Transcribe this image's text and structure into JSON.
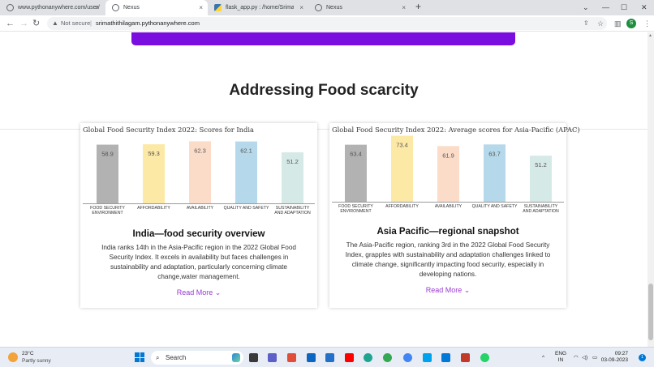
{
  "browser": {
    "tabs": [
      {
        "title": "www.pythonanywhere.com/user/",
        "favicon": "globe-icon",
        "active": false
      },
      {
        "title": "Nexus",
        "favicon": "globe-icon",
        "active": true
      },
      {
        "title": "flask_app.py : /home/SrimathiTh",
        "favicon": "python-icon",
        "active": false
      },
      {
        "title": "Nexus",
        "favicon": "globe-icon",
        "active": false
      }
    ],
    "close_glyph": "×",
    "new_tab_glyph": "+",
    "window_controls": {
      "tab_search": "⌄",
      "minimize": "—",
      "maximize": "☐",
      "close": "✕"
    },
    "nav": {
      "back": "←",
      "forward": "→",
      "reload": "↻"
    },
    "address": {
      "security_icon": "warning-icon",
      "security_glyph": "▲",
      "security_label": "Not secure",
      "separator": "|",
      "url": "srimathithilagam.pythonanywhere.com",
      "share_glyph": "⇪",
      "bookmark_glyph": "☆"
    },
    "toolbar_icons": {
      "sidebar": "▥",
      "menu": "⋮"
    },
    "profile_initial": "S",
    "profile_color": "#1e8e3e"
  },
  "page": {
    "accent_color": "#7a0ede",
    "section_title": "Addressing Food scarcity",
    "cards": [
      {
        "chart_title": "Global Food Security Index 2022: Scores for India",
        "heading": "India—food security overview",
        "body": "India ranks 14th in the Asia-Pacific region in the 2022 Global Food Security Index. It excels in availability but faces challenges in sustainability and adaptation, particularly concerning climate change,water management.",
        "read_more": "Read More ⌄"
      },
      {
        "chart_title": "Global Food Security Index 2022: Average scores for Asia-Pacific (APAC)",
        "heading": "Asia Pacific—regional snapshot",
        "body": "The Asia-Pacific region, ranking 3rd in the 2022 Global Food Security Index, grapples with sustainability and adaptation challenges linked to climate change, significantly impacting food security, especially in developing nations.",
        "read_more": "Read More ⌄"
      }
    ]
  },
  "chart_data": [
    {
      "type": "bar",
      "title": "Global Food Security Index 2022: Scores for India",
      "categories": [
        "FOOD SECURITY ENVIRONMENT",
        "AFFORDABILITY",
        "AVAILABILITY",
        "QUALITY AND SAFETY",
        "SUSTAINABILITY AND ADAPTATION"
      ],
      "category_lines": [
        [
          "FOOD SECURITY",
          "ENVIRONMENT"
        ],
        [
          "AFFORDABILITY"
        ],
        [
          "AVAILABILITY"
        ],
        [
          "QUALITY AND SAFETY"
        ],
        [
          "SUSTAINABILITY",
          "AND ADAPTATION"
        ]
      ],
      "values": [
        58.9,
        59.3,
        62.3,
        62.1,
        51.2
      ],
      "value_labels": [
        "58.9",
        "59.3",
        "62.3",
        "62.1",
        "51.2"
      ],
      "colors": [
        "#b2b2b2",
        "#fde9a6",
        "#fbdcc9",
        "#b5d9ea",
        "#d5e9e6"
      ],
      "ylim": [
        0,
        100
      ],
      "grid": false,
      "legend": "none"
    },
    {
      "type": "bar",
      "title": "Global Food Security Index 2022: Average scores for Asia-Pacific (APAC)",
      "categories": [
        "FOOD SECURITY ENVIRONMENT",
        "AFFORDABILITY",
        "AVAILABILITY",
        "QUALITY AND SAFETY",
        "SUSTAINABILITY AND ADAPTATION"
      ],
      "category_lines": [
        [
          "FOOD SECURITY",
          "ENVIRONMENT"
        ],
        [
          "AFFORDABILITY"
        ],
        [
          "AVAILABILITY"
        ],
        [
          "QUALITY AND SAFETY"
        ],
        [
          "SUSTAINABILITY",
          "AND ADAPTATION"
        ]
      ],
      "values": [
        63.4,
        73.4,
        61.9,
        63.7,
        51.2
      ],
      "value_labels": [
        "63.4",
        "73.4",
        "61.9",
        "63.7",
        "51.2"
      ],
      "colors": [
        "#b2b2b2",
        "#fde9a6",
        "#fbdcc9",
        "#b5d9ea",
        "#d5e9e6"
      ],
      "ylim": [
        0,
        100
      ],
      "grid": false,
      "legend": "none"
    }
  ],
  "taskbar": {
    "weather": {
      "temp": "23°C",
      "condition": "Partly sunny",
      "icon": "sun-icon"
    },
    "search_glyph": "⌕",
    "search_label": "Search",
    "apps": [
      {
        "name": "windows-start",
        "color": "#0078d4"
      },
      {
        "name": "taskview-icon",
        "color": "#3a3a3a"
      },
      {
        "name": "teams-icon",
        "color": "#5b5fc7"
      },
      {
        "name": "photos-icon",
        "color": "#e04e39"
      },
      {
        "name": "linkedin-icon",
        "color": "#0a66c2"
      },
      {
        "name": "store-icon",
        "color": "#2270c7"
      },
      {
        "name": "youtube-icon",
        "color": "#ff0000"
      },
      {
        "name": "edge-icon",
        "color": "#1fa58f"
      },
      {
        "name": "chrome-icon",
        "color": "#34a853"
      },
      {
        "name": "chrome-profile-icon",
        "color": "#4285f4"
      },
      {
        "name": "files-icon",
        "color": "#00a2ed"
      },
      {
        "name": "vscode-icon",
        "color": "#0078d7"
      },
      {
        "name": "app-badge-icon",
        "color": "#c0392b"
      },
      {
        "name": "whatsapp-icon",
        "color": "#25d366"
      }
    ],
    "tray": {
      "chevron": "^",
      "lang_top": "ENG",
      "lang_bottom": "IN",
      "wifi_glyph": "◠",
      "volume_glyph": "◁)",
      "battery_glyph": "▭",
      "time": "09:27",
      "date": "03-09-2023",
      "notification_count": "1"
    }
  }
}
